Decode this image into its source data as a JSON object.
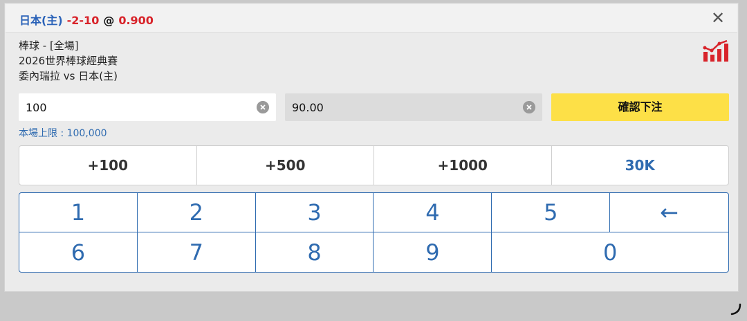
{
  "header": {
    "team": "日本(主)",
    "handicap": "-2-10",
    "at": "@",
    "odds": "0.900",
    "close_symbol": "✕"
  },
  "info": {
    "sport": "棒球 - [全場]",
    "league": "2026世界棒球經典賽",
    "match": "委內瑞拉 vs 日本(主)"
  },
  "bet": {
    "amount": "100",
    "payout": "90.00",
    "confirm_label": "確認下注"
  },
  "limit_text": "本場上限 : 100,000",
  "quick_amounts": [
    "+100",
    "+500",
    "+1000",
    "30K"
  ],
  "keypad": {
    "row1": [
      "1",
      "2",
      "3",
      "4",
      "5",
      "←"
    ],
    "row2": [
      "6",
      "7",
      "8",
      "9",
      "0"
    ]
  },
  "colors": {
    "accent_blue": "#2f6bb0",
    "odds_red": "#d8232a",
    "confirm_yellow": "#fde047"
  }
}
